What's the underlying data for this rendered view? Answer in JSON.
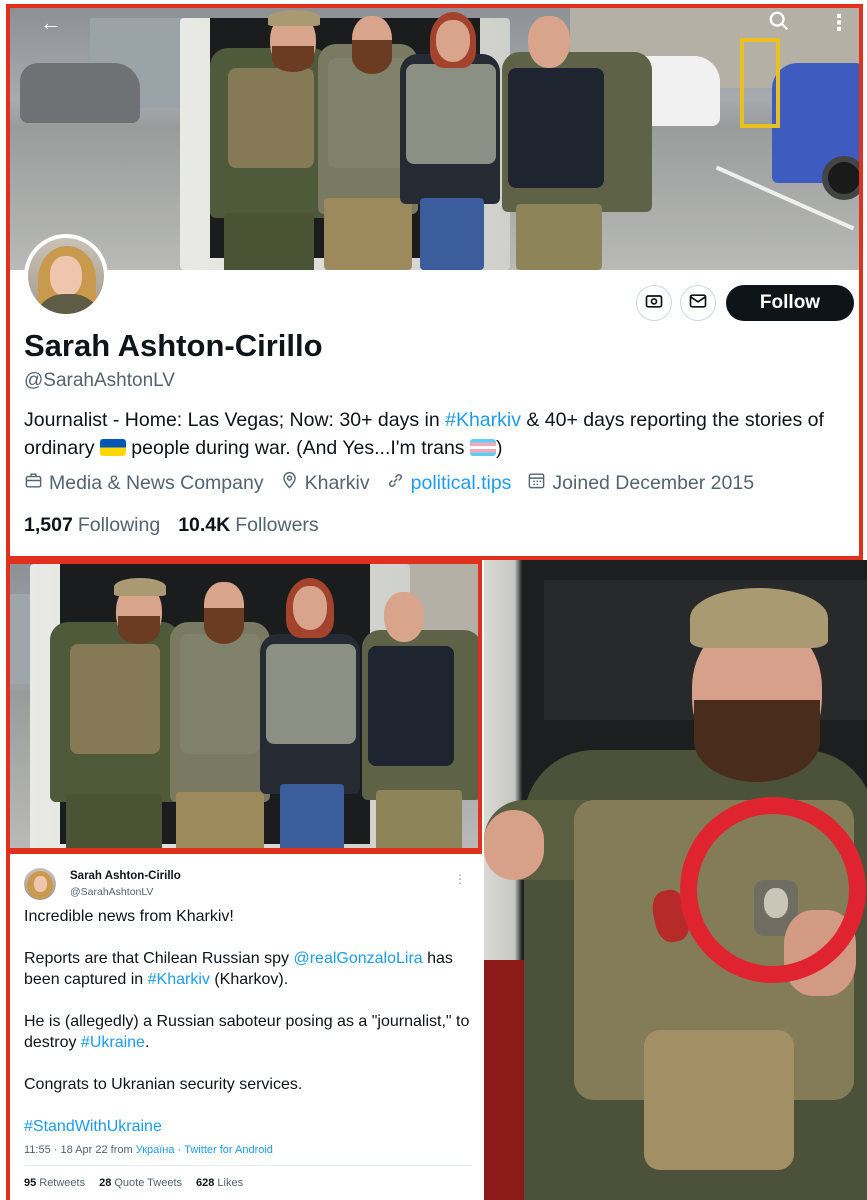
{
  "profile": {
    "display_name": "Sarah Ashton-Cirillo",
    "handle": "@SarahAshtonLV",
    "bio": {
      "part1": "Journalist - Home: Las Vegas; Now: 30+ days in ",
      "hashtag1": "#Kharkiv",
      "part2": " & 40+ days reporting the stories of  ordinary ",
      "part3": " people during war. (And Yes...I'm trans ",
      "part4": ")"
    },
    "category": "Media & News Company",
    "location": "Kharkiv",
    "website": "political.tips",
    "joined": "Joined December 2015",
    "following_count": "1,507",
    "following_label": "Following",
    "followers_count": "10.4K",
    "followers_label": "Followers",
    "follow_button": "Follow",
    "icons": {
      "back": "back-arrow-icon",
      "search": "search-icon",
      "more": "more-vertical-icon",
      "tip": "tip-jar-icon",
      "message": "envelope-icon",
      "category": "briefcase-icon",
      "location": "location-pin-icon",
      "link": "link-icon",
      "calendar": "calendar-icon"
    }
  },
  "tweet": {
    "author_name": "Sarah Ashton-Cirillo",
    "author_handle": "@SarahAshtonLV",
    "line1": "Incredible news from Kharkiv!",
    "p2_a": "Reports are that   Chilean Russian spy ",
    "p2_mention": "@realGonzaloLira",
    "p2_b": " has been captured in ",
    "p2_hashtag": "#Kharkiv",
    "p2_c": " (Kharkov).",
    "p3_a": "He is (allegedly) a  Russian saboteur posing as a \"journalist,\" to destroy ",
    "p3_hashtag": "#Ukraine",
    "p3_b": ".",
    "p4": "Congrats to Ukranian security services.",
    "hashtag_final": "#StandWithUkraine",
    "timestamp": "11:55 · 18 Apr 22 from ",
    "location_tag": "Україна",
    "source": " · Twitter for Android",
    "retweets_count": "95",
    "retweets_label": "Retweets",
    "quotes_count": "28",
    "quotes_label": "Quote Tweets",
    "likes_count": "628",
    "likes_label": "Likes"
  },
  "colors": {
    "frame_red": "#e0311f",
    "highlight_red": "#e0242f",
    "link_blue": "#1d9bf0",
    "text_primary": "#0f1419",
    "text_secondary": "#536471",
    "follow_bg": "#0f1419"
  }
}
